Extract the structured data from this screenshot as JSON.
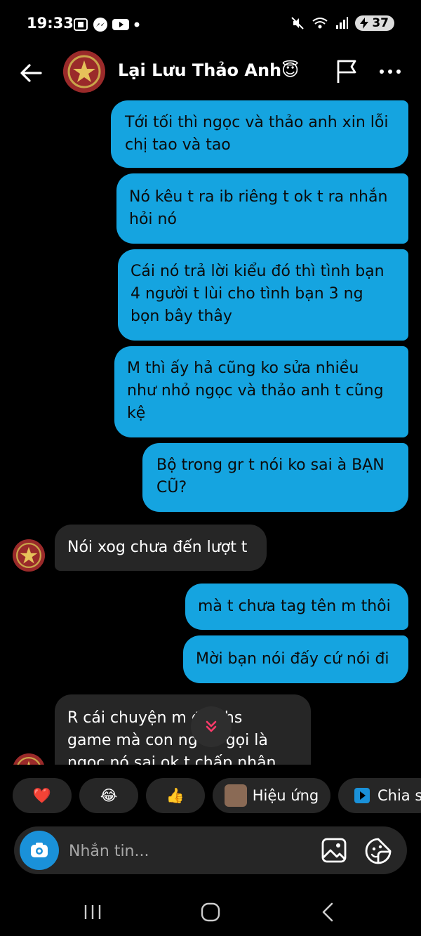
{
  "status_bar": {
    "time": "19:33",
    "battery": "37"
  },
  "header": {
    "contact_name": "Lại Lưu Thảo Anh😇"
  },
  "messages": [
    {
      "dir": "out",
      "lines": [
        "Tới tối thì ngọc và thảo anh xin lỗi",
        "chị tao và tao"
      ]
    },
    {
      "dir": "out",
      "lines": [
        "Nó kêu t ra ib riêng t ok t ra nhắn",
        "hỏi nó"
      ]
    },
    {
      "dir": "out",
      "lines": [
        "Cái nó trả lời kiểu đó thì tình bạn",
        "4 người t lùi cho tình bạn 3 ng",
        "bọn bây thây"
      ]
    },
    {
      "dir": "out",
      "lines": [
        "M thì ấy hả cũng ko sửa nhiều",
        "như nhỏ ngọc và thảo anh t cũng",
        "kệ"
      ]
    },
    {
      "dir": "out",
      "lines": [
        "Bộ trong gr t nói ko sai à BẠN",
        "CŨ?"
      ]
    },
    {
      "dir": "in",
      "lines": [
        "Nói xog chưa đến lượt t"
      ]
    },
    {
      "dir": "out",
      "lines": [
        "mà t chưa tag tên m thôi"
      ]
    },
    {
      "dir": "out",
      "lines": [
        "Mời bạn nói đấy cứ nói đi"
      ]
    },
    {
      "dir": "in",
      "lines": [
        "R cái chuyện m   đg chs",
        "game mà con ng   cứ gọi là",
        "ngọc nó sai ok t chấp nhận"
      ]
    }
  ],
  "quick_actions": {
    "reactions": [
      "❤️",
      "😂",
      "👍"
    ],
    "effects_label": "Hiệu ứng",
    "share_label": "Chia s"
  },
  "composer": {
    "placeholder": "Nhắn tin..."
  },
  "icons": {
    "back": "arrow-left-icon",
    "flag": "flag-icon",
    "more": "more-icon",
    "camera": "camera-icon",
    "gallery": "gallery-icon",
    "sticker": "sticker-icon",
    "scroll": "double-chevron-down-icon"
  },
  "colors": {
    "outgoing": "#15a4e0",
    "incoming": "#262626",
    "camera": "#1a91d9"
  }
}
